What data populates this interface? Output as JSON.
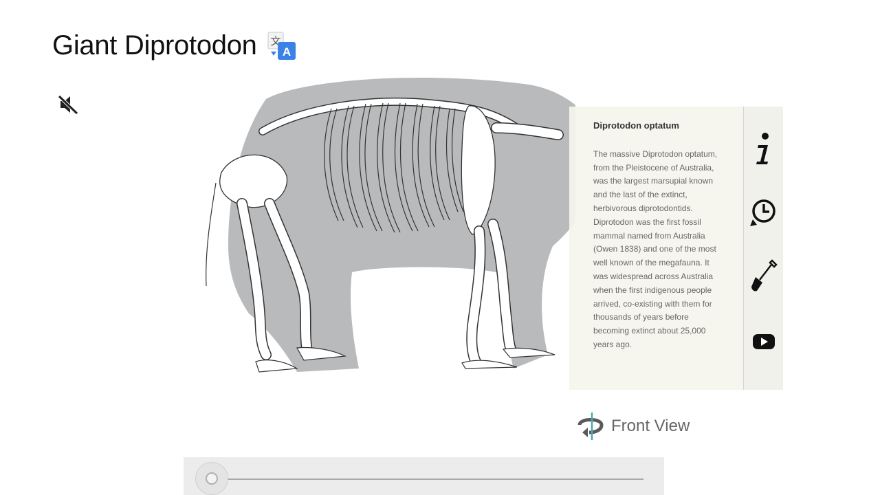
{
  "page": {
    "title": "Giant Diprotodon"
  },
  "info": {
    "heading": "Diprotodon optatum",
    "body": "The massive Diprotodon optatum, from the Pleistocene of Australia, was the largest marsupial known and the last of the extinct, herbivorous diprotodontids. Diprotodon was the first fossil mammal named from Australia (Owen 1838) and one of the most well known of the megafauna. It was widespread across Australia when the first indigenous people arrived, co-existing with them for thousands of years before becoming extinct about 25,000 years ago."
  },
  "side_tabs": [
    {
      "icon": "info-icon"
    },
    {
      "icon": "timeline-icon"
    },
    {
      "icon": "shovel-icon"
    },
    {
      "icon": "youtube-icon"
    }
  ],
  "view_toggle": {
    "label": "Front View",
    "icon": "rotate-icon"
  },
  "audio": {
    "icon": "mute-icon"
  },
  "slider": {
    "value": 0
  },
  "colors": {
    "silhouette": "#b9babc",
    "panel": "#f5f5ee",
    "accent": "#4aa7b2"
  }
}
